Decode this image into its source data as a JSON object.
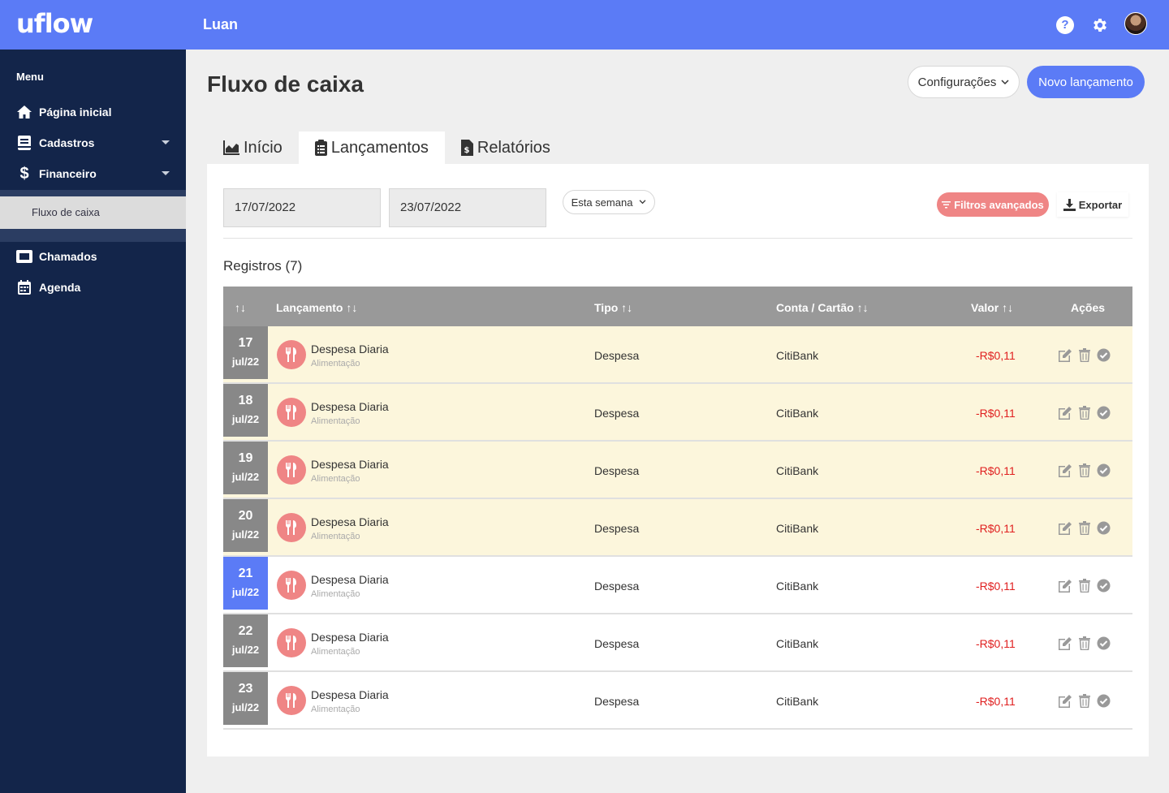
{
  "app": {
    "logo": "uflow",
    "username": "Luan"
  },
  "topbar_icons": [
    "help-icon",
    "gear-icon",
    "avatar"
  ],
  "sidebar": {
    "menu_label": "Menu",
    "items": [
      {
        "label": "Página inicial",
        "icon": "home-icon"
      },
      {
        "label": "Cadastros",
        "icon": "book-icon"
      },
      {
        "label": "Financeiro",
        "icon": "dollar-icon"
      },
      {
        "label": "Chamados",
        "icon": "ticket-icon"
      },
      {
        "label": "Agenda",
        "icon": "calendar-icon"
      }
    ],
    "sub_item": "Fluxo de caixa"
  },
  "page": {
    "title": "Fluxo de caixa",
    "config_button": "Configurações",
    "new_button": "Novo lançamento"
  },
  "tabs": [
    {
      "label": "Início",
      "icon": "chart-icon"
    },
    {
      "label": "Lançamentos",
      "icon": "clipboard-icon"
    },
    {
      "label": "Relatórios",
      "icon": "file-dollar-icon"
    }
  ],
  "filters": {
    "start_date": "17/07/2022",
    "end_date": "23/07/2022",
    "period": "Esta semana",
    "advanced_button": "Filtros avançados",
    "export_button": "Exportar"
  },
  "records_label": "Registros (7)",
  "table": {
    "headers": {
      "sort": "↑↓",
      "lancamento": "Lançamento ↑↓",
      "tipo": "Tipo ↑↓",
      "conta": "Conta / Cartão ↑↓",
      "valor": "Valor ↑↓",
      "acoes": "Ações"
    },
    "rows": [
      {
        "day": "17",
        "month": "jul/22",
        "title": "Despesa Diaria",
        "category": "Alimentação",
        "tipo": "Despesa",
        "conta": "CitiBank",
        "valor": "-R$0,11"
      },
      {
        "day": "18",
        "month": "jul/22",
        "title": "Despesa Diaria",
        "category": "Alimentação",
        "tipo": "Despesa",
        "conta": "CitiBank",
        "valor": "-R$0,11"
      },
      {
        "day": "19",
        "month": "jul/22",
        "title": "Despesa Diaria",
        "category": "Alimentação",
        "tipo": "Despesa",
        "conta": "CitiBank",
        "valor": "-R$0,11"
      },
      {
        "day": "20",
        "month": "jul/22",
        "title": "Despesa Diaria",
        "category": "Alimentação",
        "tipo": "Despesa",
        "conta": "CitiBank",
        "valor": "-R$0,11"
      },
      {
        "day": "21",
        "month": "jul/22",
        "title": "Despesa Diaria",
        "category": "Alimentação",
        "tipo": "Despesa",
        "conta": "CitiBank",
        "valor": "-R$0,11"
      },
      {
        "day": "22",
        "month": "jul/22",
        "title": "Despesa Diaria",
        "category": "Alimentação",
        "tipo": "Despesa",
        "conta": "CitiBank",
        "valor": "-R$0,11"
      },
      {
        "day": "23",
        "month": "jul/22",
        "title": "Despesa Diaria",
        "category": "Alimentação",
        "tipo": "Despesa",
        "conta": "CitiBank",
        "valor": "-R$0,11"
      }
    ]
  },
  "colors": {
    "primary": "#5b7bf6",
    "sidebar": "#13254a",
    "danger": "#ef8585",
    "past_row": "#fcf6dc",
    "negative_value": "#e02020"
  }
}
